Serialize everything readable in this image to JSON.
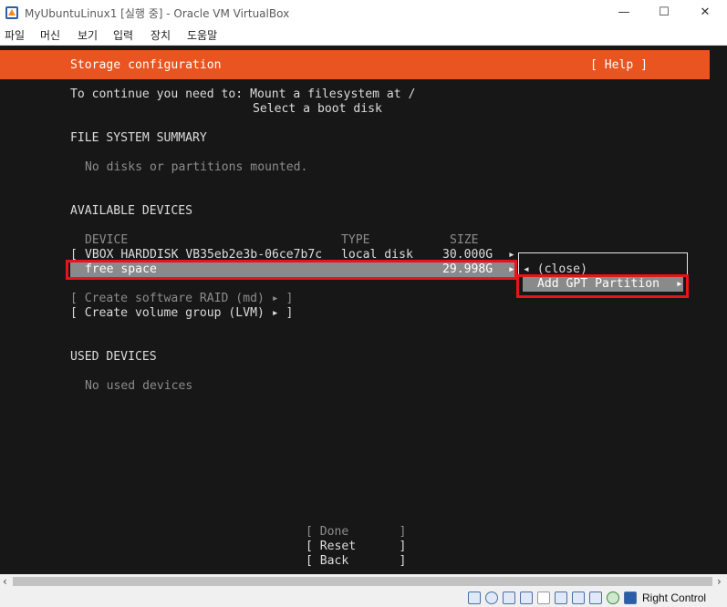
{
  "window": {
    "title": "MyUbuntuLinux1 [실행 중] - Oracle VM VirtualBox",
    "minimize": "—",
    "maximize": "☐",
    "close": "✕"
  },
  "menu": [
    "파일",
    "머신",
    "보기",
    "입력",
    "장치",
    "도움말"
  ],
  "installer": {
    "header_title": "Storage configuration",
    "help": "[ Help ]",
    "instructions_line1": "To continue you need to: Mount a filesystem at /",
    "instructions_line2": "Select a boot disk",
    "fs_summary_heading": "FILE SYSTEM SUMMARY",
    "fs_summary_empty": "No disks or partitions mounted.",
    "available_heading": "AVAILABLE DEVICES",
    "col_device": "DEVICE",
    "col_type": "TYPE",
    "col_size": "SIZE",
    "disk_bracket": "[",
    "disk_name": "VBOX_HARDDISK_VB35eb2e3b-06ce7b7c",
    "disk_type": "local disk",
    "disk_size": "30.000G",
    "disk_arrow": "▸",
    "free_label": "free space",
    "free_size": "29.998G",
    "free_arrow": "▸",
    "create_raid": "[ Create software RAID (md) ▸ ]",
    "create_lvm": "[ Create volume group (LVM) ▸ ]",
    "used_heading": "USED DEVICES",
    "used_empty": "No used devices",
    "popup_close": "◂ (close)",
    "popup_add_gpt": "Add GPT Partition",
    "popup_add_arrow": "▸",
    "btn_done": "[ Done       ]",
    "btn_reset": "[ Reset      ]",
    "btn_back": "[ Back       ]"
  },
  "statusbar": {
    "host_key": "Right Control"
  }
}
